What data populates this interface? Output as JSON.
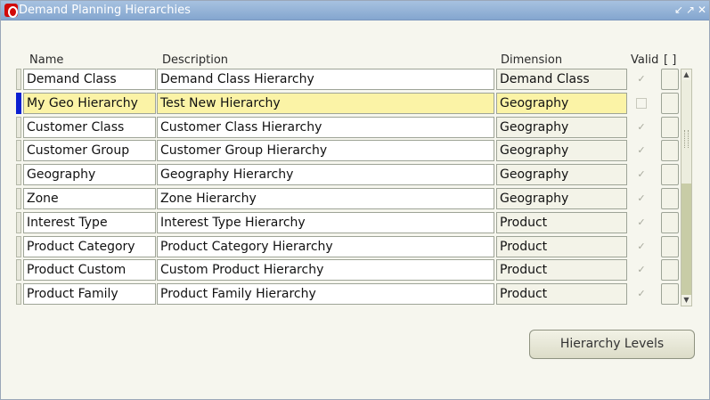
{
  "window": {
    "title": "Demand Planning Hierarchies",
    "controls": {
      "minimize": "↙",
      "maximize": "↗",
      "close": "✕"
    }
  },
  "columns": {
    "name": "Name",
    "description": "Description",
    "dimension": "Dimension",
    "valid": "Valid",
    "flex": "[ ]"
  },
  "rows": [
    {
      "name": "Demand Class",
      "description": "Demand Class Hierarchy",
      "dimension": "Demand Class",
      "valid": true
    },
    {
      "name": "My Geo Hierarchy",
      "description": "Test New Hierarchy",
      "dimension": "Geography",
      "valid": false
    },
    {
      "name": "Customer Class",
      "description": "Customer Class Hierarchy",
      "dimension": "Geography",
      "valid": true
    },
    {
      "name": "Customer Group",
      "description": "Customer Group Hierarchy",
      "dimension": "Geography",
      "valid": true
    },
    {
      "name": "Geography",
      "description": "Geography Hierarchy",
      "dimension": "Geography",
      "valid": true
    },
    {
      "name": "Zone",
      "description": "Zone Hierarchy",
      "dimension": "Geography",
      "valid": true
    },
    {
      "name": "Interest Type",
      "description": "Interest Type Hierarchy",
      "dimension": "Product",
      "valid": true
    },
    {
      "name": "Product Category",
      "description": "Product Category Hierarchy",
      "dimension": "Product",
      "valid": true
    },
    {
      "name": "Product Custom",
      "description": "Custom Product Hierarchy",
      "dimension": "Product",
      "valid": true
    },
    {
      "name": "Product Family",
      "description": "Product Family Hierarchy",
      "dimension": "Product",
      "valid": true
    }
  ],
  "selected_row_index": 1,
  "scrollbar": {
    "up": "▲",
    "down": "▼"
  },
  "buttons": {
    "hierarchy_levels": "Hierarchy Levels"
  },
  "icons": {
    "check": "✓",
    "app": "oracle-app-icon"
  },
  "colors": {
    "selected_row": "#fbf3a6",
    "current_marker": "#0b1fd1",
    "titlebar": "#94b2d8"
  }
}
